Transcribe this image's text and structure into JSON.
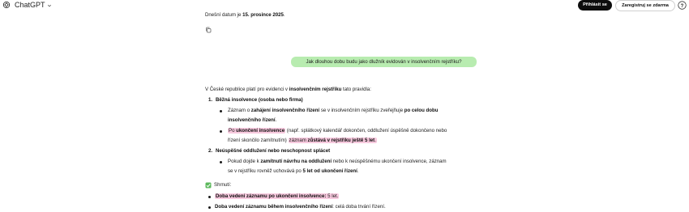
{
  "header": {
    "app_title": "ChatGPT",
    "login_label": "Přihlásit se",
    "register_label": "Zaregistruj se zdarma",
    "help_label": "?"
  },
  "conversation": {
    "date_line": {
      "prefix": "Dnešní datum je ",
      "date": "15. prosince 2025",
      "suffix": "."
    },
    "user_message": "Jak dlouhou dobu budu jako dlužník evidován v insolvenčním rejstříku?",
    "intro": {
      "prefix": "V České republice platí pro evidenci v ",
      "bold": "insolvenčním rejstříku",
      "suffix": " tato pravidla:"
    },
    "items": [
      {
        "number": "1.",
        "title": "Běžná insolvence (osoba nebo firma)",
        "b1": {
          "p1": "Záznam o ",
          "b1": "zahájení insolvenčního řízení",
          "p2": " se v insolvenčním rejstříku zveřejňuje ",
          "b2": "po celou dobu",
          "line2": "insolvenčního řízení",
          "line2_end": "."
        },
        "b2": {
          "hl1": "Po ",
          "hl1b": "ukončení insolvence",
          "p1": " (např. splátkový kalendář dokončen, oddlužení úspěšně dokončeno nebo",
          "p2": "řízení skončilo zamítnutím) ",
          "hl2": "záznam ",
          "hl2b": "zůstává v rejstříku ještě 5 let",
          "hl2end": "."
        }
      },
      {
        "number": "2.",
        "title": "Neúspěšné oddlužení nebo neschopnost splácet",
        "b1": {
          "p1": "Pokud dojde k ",
          "b1": "zamítnutí návrhu na oddlužení",
          "p2": " nebo k neúspěšnému ukončení insolvence, záznam",
          "p3": "se v rejstříku rovněž uchovává po ",
          "b2": "5 let od ukončení řízení",
          "p4": "."
        }
      }
    ],
    "summary_label": "Shrnutí:",
    "summary": [
      {
        "bold": "Doba vedení záznamu po ukončení insolvence:",
        "text": " 5 let."
      },
      {
        "bold": "Doba vedení záznamu během insolvenčního řízení",
        "text": ": celá doba trvání řízení."
      }
    ]
  }
}
